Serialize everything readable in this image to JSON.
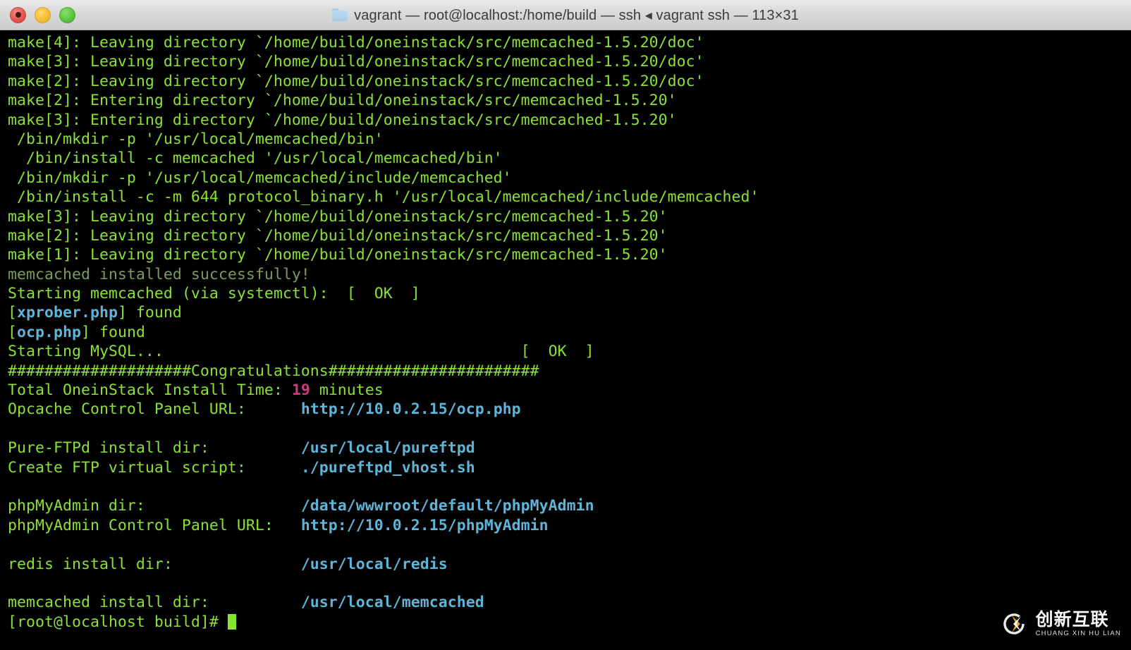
{
  "window": {
    "title": "vagrant — root@localhost:/home/build — ssh ◂ vagrant ssh — 113×31",
    "folder_icon": "folder-icon",
    "controls": {
      "close_label": "close-button",
      "minimize_label": "minimize-button",
      "maximize_label": "maximize-button"
    }
  },
  "colors": {
    "background": "#000000",
    "foreground_green": "#8ae234",
    "dim_green": "#7d9a5e",
    "cyan": "#5fb4d8",
    "magenta": "#d33682",
    "titlebar": "#d8d8d8"
  },
  "terminal": {
    "cols": 113,
    "rows": 31,
    "prompt": "[root@localhost build]# ",
    "cursor": "block-cursor",
    "lines": [
      {
        "text": "make[4]: Leaving directory `/home/build/oneinstack/src/memcached-1.5.20/doc'"
      },
      {
        "text": "make[3]: Leaving directory `/home/build/oneinstack/src/memcached-1.5.20/doc'"
      },
      {
        "text": "make[2]: Leaving directory `/home/build/oneinstack/src/memcached-1.5.20/doc'"
      },
      {
        "text": "make[2]: Entering directory `/home/build/oneinstack/src/memcached-1.5.20'"
      },
      {
        "text": "make[3]: Entering directory `/home/build/oneinstack/src/memcached-1.5.20'"
      },
      {
        "text": " /bin/mkdir -p '/usr/local/memcached/bin'"
      },
      {
        "text": "  /bin/install -c memcached '/usr/local/memcached/bin'"
      },
      {
        "text": " /bin/mkdir -p '/usr/local/memcached/include/memcached'"
      },
      {
        "text": " /bin/install -c -m 644 protocol_binary.h '/usr/local/memcached/include/memcached'"
      },
      {
        "text": "make[3]: Leaving directory `/home/build/oneinstack/src/memcached-1.5.20'"
      },
      {
        "text": "make[2]: Leaving directory `/home/build/oneinstack/src/memcached-1.5.20'"
      },
      {
        "text": "make[1]: Leaving directory `/home/build/oneinstack/src/memcached-1.5.20'"
      },
      {
        "text": "memcached installed successfully!",
        "style": "dim"
      },
      {
        "text": "Starting memcached (via systemctl):  [  OK  ]"
      },
      {
        "segments": [
          {
            "t": "[",
            "c": "g"
          },
          {
            "t": "xprober.php",
            "c": "cy"
          },
          {
            "t": "] found",
            "c": "g"
          }
        ]
      },
      {
        "segments": [
          {
            "t": "[",
            "c": "g"
          },
          {
            "t": "ocp.php",
            "c": "cy"
          },
          {
            "t": "] found",
            "c": "g"
          }
        ]
      },
      {
        "text": "Starting MySQL...                                       [  OK  ]"
      },
      {
        "text": "####################Congratulations#######################"
      },
      {
        "segments": [
          {
            "t": "Total OneinStack Install Time: ",
            "c": "g"
          },
          {
            "t": "19",
            "c": "mg"
          },
          {
            "t": " minutes",
            "c": "g"
          }
        ]
      },
      {
        "segments": [
          {
            "t": "Opcache Control Panel URL:      ",
            "c": "g"
          },
          {
            "t": "http://10.0.2.15/ocp.php",
            "c": "cy"
          }
        ]
      },
      {
        "text": ""
      },
      {
        "segments": [
          {
            "t": "Pure-FTPd install dir:          ",
            "c": "g"
          },
          {
            "t": "/usr/local/pureftpd",
            "c": "cy"
          }
        ]
      },
      {
        "segments": [
          {
            "t": "Create FTP virtual script:      ",
            "c": "g"
          },
          {
            "t": "./pureftpd_vhost.sh",
            "c": "cy"
          }
        ]
      },
      {
        "text": ""
      },
      {
        "segments": [
          {
            "t": "phpMyAdmin dir:                 ",
            "c": "g"
          },
          {
            "t": "/data/wwwroot/default/phpMyAdmin",
            "c": "cy"
          }
        ]
      },
      {
        "segments": [
          {
            "t": "phpMyAdmin Control Panel URL:   ",
            "c": "g"
          },
          {
            "t": "http://10.0.2.15/phpMyAdmin",
            "c": "cy"
          }
        ]
      },
      {
        "text": ""
      },
      {
        "segments": [
          {
            "t": "redis install dir:              ",
            "c": "g"
          },
          {
            "t": "/usr/local/redis",
            "c": "cy"
          }
        ]
      },
      {
        "text": ""
      },
      {
        "segments": [
          {
            "t": "memcached install dir:          ",
            "c": "g"
          },
          {
            "t": "/usr/local/memcached",
            "c": "cy"
          }
        ]
      },
      {
        "prompt": true
      }
    ]
  },
  "watermark": {
    "logo_icon": "chuangxinhulian-logo-icon",
    "chinese": "创新互联",
    "pinyin": "CHUANG XIN HU LIAN"
  }
}
